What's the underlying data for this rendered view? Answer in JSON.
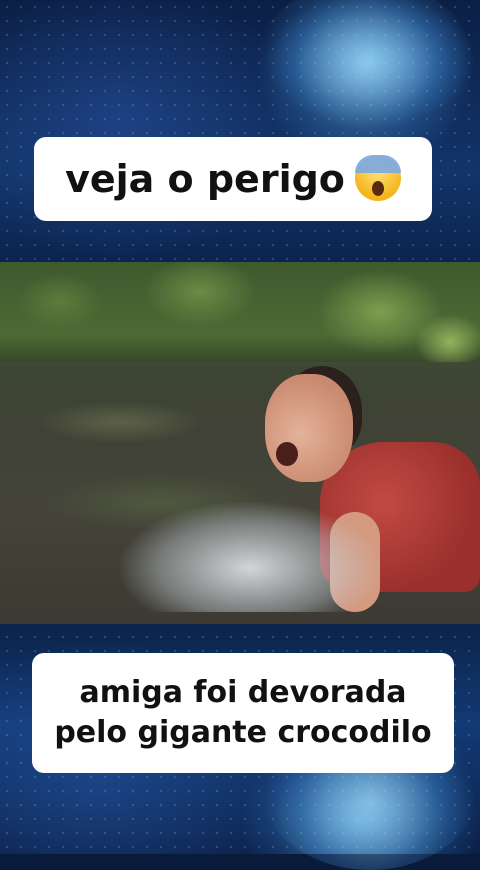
{
  "top_caption": {
    "text": "veja o perigo",
    "emoji": "face-screaming-in-fear-emoji"
  },
  "bottom_caption": {
    "line1": "amiga foi devorada",
    "line2": "pelo gigante crocodilo"
  },
  "colors": {
    "background": "#0a1d40",
    "caption_bg": "#ffffff",
    "caption_text": "#111111"
  }
}
